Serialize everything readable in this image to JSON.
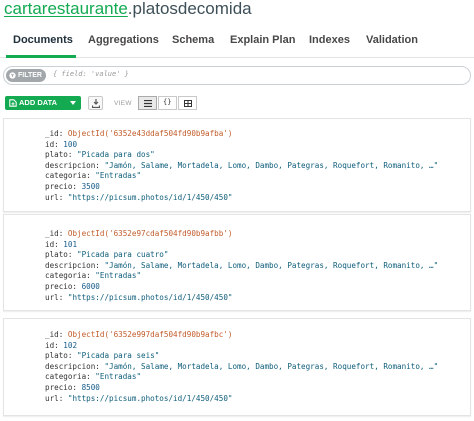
{
  "namespace": {
    "database": "cartarestaurante",
    "separator": ".",
    "collection": "platosdecomida"
  },
  "tabs": [
    {
      "label": "Documents",
      "active": true
    },
    {
      "label": "Aggregations"
    },
    {
      "label": "Schema"
    },
    {
      "label": "Explain Plan"
    },
    {
      "label": "Indexes"
    },
    {
      "label": "Validation"
    }
  ],
  "filter": {
    "label": "FILTER",
    "placeholder": "{ field: 'value' }",
    "icon": "filter-icon"
  },
  "toolbar": {
    "add_data_label": "ADD DATA",
    "view_label": "VIEW",
    "icons": [
      "import-icon",
      "list-view-icon",
      "json-view-icon",
      "table-view-icon"
    ]
  },
  "colors": {
    "brand_green": "#13aa52",
    "objectid": "#c25c2b",
    "number": "#145a8a",
    "string": "#0d5d7a"
  },
  "documents": [
    {
      "id_line": "ObjectId('6352e43ddaf504fd90b9afba')",
      "id": "100",
      "plato": "\"Picada para dos\"",
      "descripcion": "\"Jamón, Salame, Mortadela, Lomo, Dambo, Pategras, Roquefort, Romanito, …\"",
      "categoria": "\"Entradas\"",
      "precio": "3500",
      "url": "\"https://picsum.photos/id/1/450/450\""
    },
    {
      "id_line": "ObjectId('6352e97cdaf504fd90b9afbb')",
      "id": "101",
      "plato": "\"Picada para cuatro\"",
      "descripcion": "\"Jamón, Salame, Mortadela, Lomo, Dambo, Pategras, Roquefort, Romanito, …\"",
      "categoria": "\"Entradas\"",
      "precio": "6000",
      "url": "\"https://picsum.photos/id/1/450/450\""
    },
    {
      "id_line": "ObjectId('6352e997daf504fd90b9afbc')",
      "id": "102",
      "plato": "\"Picada para seis\"",
      "descripcion": "\"Jamón, Salame, Mortadela, Lomo, Dambo, Pategras, Roquefort, Romanito, …\"",
      "categoria": "\"Entradas\"",
      "precio": "8500",
      "url": "\"https://picsum.photos/id/1/450/450\""
    }
  ],
  "field_keys": {
    "oid": "_id:",
    "id": "id:",
    "plato": "plato:",
    "descripcion": "descripcion:",
    "categoria": "categoria:",
    "precio": "precio:",
    "url": "url:"
  }
}
